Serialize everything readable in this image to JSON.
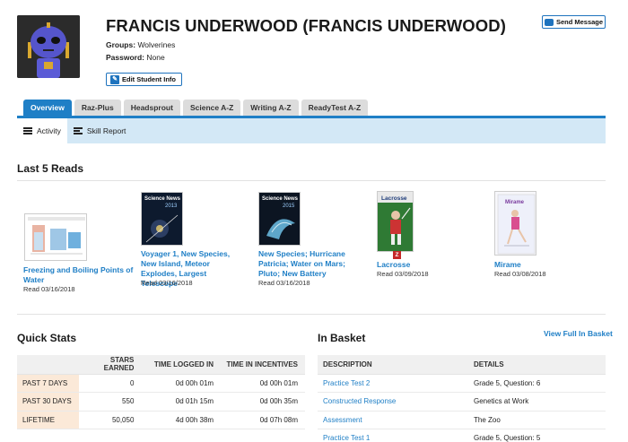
{
  "student": {
    "name": "FRANCIS UNDERWOOD (FRANCIS UNDERWOOD)",
    "groups_label": "Groups:",
    "groups_value": "Wolverines",
    "password_label": "Password:",
    "password_value": "None",
    "edit_label": "Edit Student Info",
    "message_label": "Send Message"
  },
  "tabs": [
    "Overview",
    "Raz-Plus",
    "Headsprout",
    "Science A-Z",
    "Writing A-Z",
    "ReadyTest A-Z"
  ],
  "subnav": {
    "activity": "Activity",
    "skill_report": "Skill Report"
  },
  "last_reads": {
    "title": "Last 5 Reads",
    "books": [
      {
        "title": "Freezing and Boiling Points of Water",
        "date": "Read 03/16/2018"
      },
      {
        "title": "Voyager 1, New Species, New Island, Meteor Explodes, Largest Telescope",
        "date": "Read 03/16/2018",
        "cover_text": "Science News",
        "cover_year": "2013"
      },
      {
        "title": "New Species; Hurricane Patricia; Water on Mars; Pluto; New Battery",
        "date": "Read 03/16/2018",
        "cover_text": "Science News",
        "cover_year": "2015"
      },
      {
        "title": "Lacrosse",
        "date": "Read 03/09/2018",
        "cover_text": "Lacrosse",
        "badge": "Z"
      },
      {
        "title": "Mirame",
        "date": "Read 03/08/2018",
        "cover_text": "Mirame"
      }
    ]
  },
  "quick_stats": {
    "title": "Quick Stats",
    "headers": [
      "",
      "STARS EARNED",
      "TIME LOGGED IN",
      "TIME IN INCENTIVES"
    ],
    "rows": [
      {
        "label": "PAST 7 DAYS",
        "stars": "0",
        "logged": "0d 00h 01m",
        "incentives": "0d 00h 01m"
      },
      {
        "label": "PAST 30 DAYS",
        "stars": "550",
        "logged": "0d 01h 15m",
        "incentives": "0d 00h 35m"
      },
      {
        "label": "LIFETIME",
        "stars": "50,050",
        "logged": "4d 00h 38m",
        "incentives": "0d 07h 08m"
      }
    ]
  },
  "basket": {
    "title": "In Basket",
    "view_full": "View Full In Basket",
    "headers": [
      "DESCRIPTION",
      "DETAILS"
    ],
    "rows": [
      {
        "desc": "Practice Test 2",
        "details": "Grade 5, Question: 6"
      },
      {
        "desc": "Constructed Response",
        "details": "Genetics at Work"
      },
      {
        "desc": "Assessment",
        "details": "The Zoo"
      },
      {
        "desc": "Practice Test 1",
        "details": "Grade 5, Question: 5"
      }
    ]
  },
  "colors": {
    "accent": "#1f7fc6",
    "subnav_bg": "#d3e8f6",
    "stat_label_bg": "#fbe9d8"
  }
}
